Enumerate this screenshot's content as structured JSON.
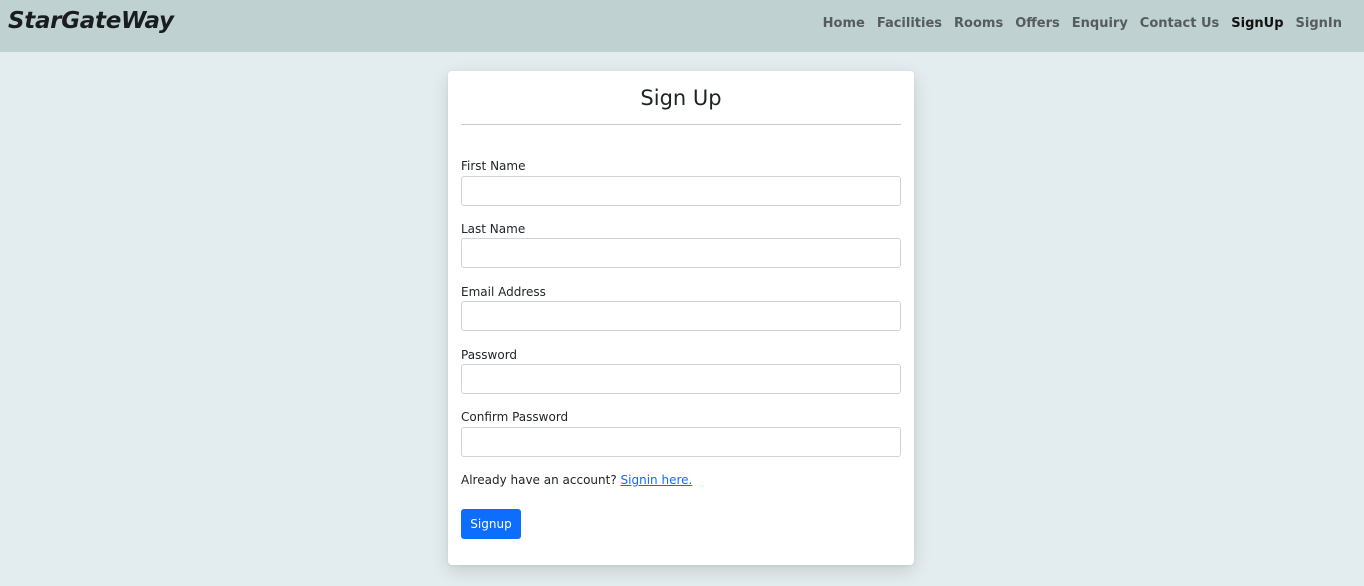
{
  "navbar": {
    "brand": "StarGateWay",
    "links": [
      {
        "label": "Home"
      },
      {
        "label": "Facilities"
      },
      {
        "label": "Rooms"
      },
      {
        "label": "Offers"
      },
      {
        "label": "Enquiry"
      },
      {
        "label": "Contact Us"
      },
      {
        "label": "SignUp",
        "active": true
      },
      {
        "label": "SignIn"
      }
    ]
  },
  "form": {
    "title": "Sign Up",
    "fields": [
      {
        "label": "First Name",
        "value": ""
      },
      {
        "label": "Last Name",
        "value": ""
      },
      {
        "label": "Email Address",
        "value": ""
      },
      {
        "label": "Password",
        "value": ""
      },
      {
        "label": "Confirm Password",
        "value": ""
      }
    ],
    "signin_prompt": "Already have an account?",
    "signin_link": "Signin here.",
    "submit_label": "Signup"
  },
  "colors": {
    "navbar_bg": "#bfd1d1",
    "page_bg": "#e3ecee",
    "primary": "#0d6efd"
  }
}
